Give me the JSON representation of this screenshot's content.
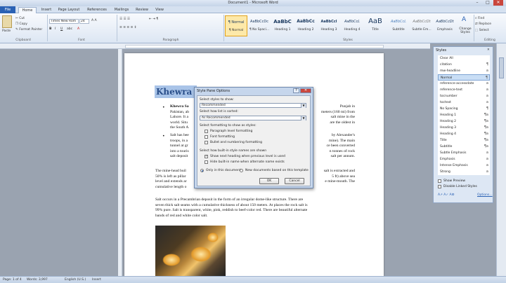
{
  "window": {
    "title": "Document1 - Microsoft Word",
    "min": "–",
    "max": "□",
    "close": "✕"
  },
  "tabs": {
    "file": "File",
    "items": [
      "Home",
      "Insert",
      "Page Layout",
      "References",
      "Mailings",
      "Review",
      "View"
    ]
  },
  "ribbon": {
    "clipboard": {
      "paste": "Paste",
      "cut": "Cut",
      "copy": "Copy",
      "format_painter": "Format Painter",
      "label": "Clipboard"
    },
    "font": {
      "name": "Times New Rom",
      "size": "24",
      "label": "Font"
    },
    "paragraph": {
      "label": "Paragraph"
    },
    "styles": {
      "items": [
        {
          "sample": "¶ Normal",
          "name": "¶ Normal"
        },
        {
          "sample": "AaBbCcDc",
          "name": "¶ No Spaci..."
        },
        {
          "sample": "AaBbC",
          "name": "Heading 1"
        },
        {
          "sample": "AaBbCc",
          "name": "Heading 2"
        },
        {
          "sample": "AaBbCcl",
          "name": "Heading 3"
        },
        {
          "sample": "AaBbCcL",
          "name": "Heading 4"
        },
        {
          "sample": "AaB",
          "name": "Title"
        },
        {
          "sample": "AaBbCcL",
          "name": "Subtitle"
        },
        {
          "sample": "AaBbCcDt",
          "name": "Subtle Em..."
        },
        {
          "sample": "AaBbCcDt",
          "name": "Emphasis"
        }
      ],
      "change_styles": "Change Styles",
      "label": "Styles"
    },
    "editing": {
      "find": "Find",
      "replace": "Replace",
      "select": "Select",
      "label": "Editing"
    }
  },
  "document": {
    "heading": "Khewra S",
    "bullet1": [
      "Khewra Sa",
      "Pakistan, ab",
      "Lahore. It a",
      "world. Situ",
      "the South A"
    ],
    "bullet1_bold": "Khewra Sa",
    "bullet1_right": [
      "Punjab in",
      "meters (160 mi) from",
      "salt mine in the",
      "are the oldest in",
      ""
    ],
    "bullet2": [
      "Salt has bee",
      "troops, in a",
      "tunnel at gr",
      "into a touris",
      "salt deposit"
    ],
    "bullet2_right": [
      "by Alexander's",
      "mine). The main",
      "ce been converted",
      "n tonnes of rock",
      "salt per annum."
    ],
    "para1": [
      "The mine-head buil",
      "50% is left as pillar",
      "level and extends ar",
      "cumulative length o"
    ],
    "para1_right": [
      "salt is extracted and",
      "5 ft) above sea",
      "e mine-mouth. The",
      ""
    ],
    "para2": [
      "Salt occurs in a Precambrian deposit in the form of an irregular dome-like structure. There are",
      "seven thick salt seams with a cumulative thickness of about 150 meters. At places the rock salt is",
      "99% pure. Salt is transparent, white, pink, reddish to beef-color red. There are beautiful alternate",
      "bands of red and white color salt."
    ]
  },
  "dialog": {
    "title": "Style Pane Options",
    "help": "?",
    "close": "✕",
    "select_styles_label": "Select styles to show:",
    "select_styles_value": "Recommended",
    "sort_label": "Select how list is sorted:",
    "sort_value": "As Recommended",
    "formatting_label": "Select formatting to show as styles:",
    "checks": [
      "Paragraph level formatting",
      "Font formatting",
      "Bullet and numbering formatting"
    ],
    "builtin_label": "Select how built-in style names are shown",
    "builtin_checks": [
      "Show next heading when previous level is used",
      "Hide built-in name when alternate name exists"
    ],
    "radio_doc": "Only in this document",
    "radio_template": "New documents based on this template",
    "ok": "OK",
    "cancel": "Cancel"
  },
  "styles_pane": {
    "title": "Styles",
    "close": "✕",
    "items": [
      {
        "name": "Clear All",
        "mark": ""
      },
      {
        "name": "citation",
        "mark": "¶"
      },
      {
        "name": "mw-headline",
        "mark": "a"
      },
      {
        "name": "Normal",
        "mark": "¶"
      },
      {
        "name": "reference-accessdate",
        "mark": "a"
      },
      {
        "name": "reference-text",
        "mark": "a"
      },
      {
        "name": "tocnumber",
        "mark": "a"
      },
      {
        "name": "toctext",
        "mark": "a"
      },
      {
        "name": "No Spacing",
        "mark": "¶"
      },
      {
        "name": "Heading 1",
        "mark": "¶a"
      },
      {
        "name": "Heading 2",
        "mark": "¶a"
      },
      {
        "name": "Heading 3",
        "mark": "¶a"
      },
      {
        "name": "Heading 4",
        "mark": "¶a"
      },
      {
        "name": "Title",
        "mark": "¶a"
      },
      {
        "name": "Subtitle",
        "mark": "¶a"
      },
      {
        "name": "Subtle Emphasis",
        "mark": "a"
      },
      {
        "name": "Emphasis",
        "mark": "a"
      },
      {
        "name": "Intense Emphasis",
        "mark": "a"
      },
      {
        "name": "Strong",
        "mark": "a"
      }
    ],
    "show_preview": "Show Preview",
    "disable_linked": "Disable Linked Styles",
    "options": "Options..."
  },
  "status": {
    "page": "Page: 1 of 4",
    "words": "Words: 3,997",
    "lang": "English (U.S.)",
    "insert": "Insert"
  },
  "colors": {
    "accent": "#2b62b4",
    "heading_bg": "#a9c4e8"
  }
}
